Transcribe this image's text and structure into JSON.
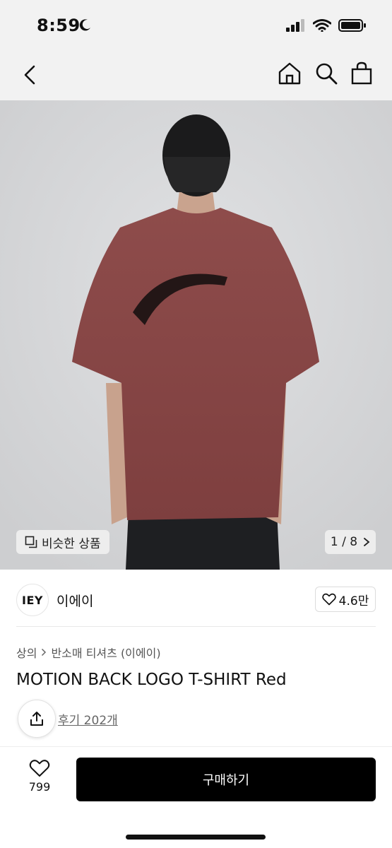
{
  "status": {
    "time": "8:59"
  },
  "nav": {
    "back_icon": "chevron-left-icon",
    "home_icon": "home-icon",
    "search_icon": "search-icon",
    "bag_icon": "shopping-bag-icon"
  },
  "gallery": {
    "similar_label": "비슷한 상품",
    "page_indicator": "1 / 8",
    "current_page": 1,
    "total_pages": 8
  },
  "brand": {
    "logo_text": "IEY",
    "name": "이에이",
    "likes": "4.6만"
  },
  "product": {
    "breadcrumb": [
      "상의",
      "반소매 티셔츠 (이에이)"
    ],
    "title": "MOTION BACK LOGO T-SHIRT Red",
    "reviews": "후기 202개"
  },
  "bottom": {
    "wish_count": "799",
    "buy_label": "구매하기"
  },
  "colors": {
    "shirt": "#8a4a4a",
    "background": "#d8d9db",
    "buy_button": "#000000"
  }
}
